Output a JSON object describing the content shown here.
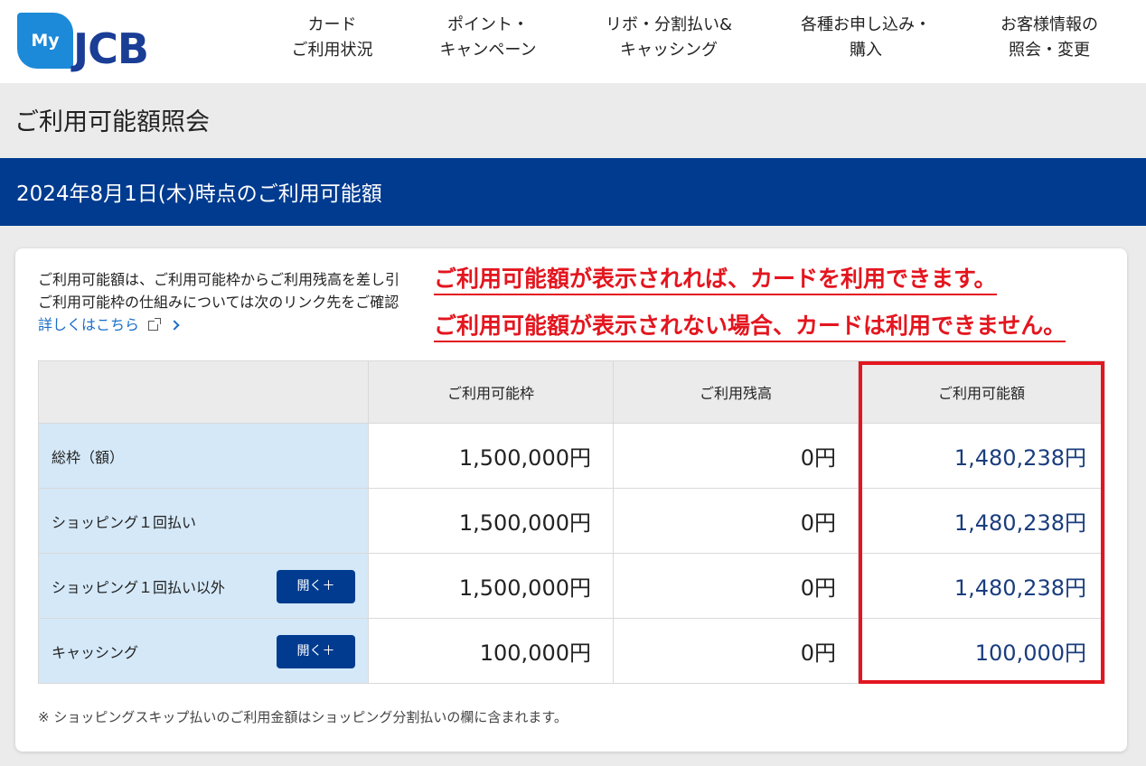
{
  "logo": {
    "badge": "My",
    "text": "JCB"
  },
  "nav": [
    {
      "line1": "カード",
      "line2": "ご利用状況"
    },
    {
      "line1": "ポイント・",
      "line2": "キャンペーン"
    },
    {
      "line1": "リボ・分割払い&",
      "line2": "キャッシング"
    },
    {
      "line1": "各種お申し込み・",
      "line2": "購入"
    },
    {
      "line1": "お客様情報の",
      "line2": "照会・変更"
    }
  ],
  "page_title": "ご利用可能額照会",
  "band_title": "2024年8月1日(木)時点のご利用可能額",
  "description": {
    "line1": "ご利用可能額は、ご利用可能枠からご利用残高を差し引",
    "line2": "ご利用可能枠の仕組みについては次のリンク先をご確認",
    "link": "詳しくはこちら"
  },
  "annotations": {
    "note1": "ご利用可能額が表示されれば、カードを利用できます。",
    "note2": "ご利用可能額が表示されない場合、カードは利用できません。"
  },
  "table": {
    "headers": [
      "",
      "ご利用可能枠",
      "ご利用残高",
      "ご利用可能額"
    ],
    "rows": [
      {
        "label": "総枠（額）",
        "limit": "1,500,000円",
        "balance": "0円",
        "available": "1,480,238円"
      },
      {
        "label": "ショッピング１回払い",
        "limit": "1,500,000円",
        "balance": "0円",
        "available": "1,480,238円"
      },
      {
        "label": "ショッピング１回払い以外",
        "limit": "1,500,000円",
        "balance": "0円",
        "available": "1,480,238円",
        "button": "開く＋"
      },
      {
        "label": "キャッシング",
        "limit": "100,000円",
        "balance": "0円",
        "available": "100,000円",
        "button": "開く＋"
      }
    ]
  },
  "footnote": "※ ショッピングスキップ払いのご利用金額はショッピング分割払いの欄に含まれます。",
  "colors": {
    "brand_blue": "#003b8f",
    "logo_blue": "#1c8ad8",
    "highlight_red": "#e3161f",
    "label_bg": "#d4e8f8"
  }
}
